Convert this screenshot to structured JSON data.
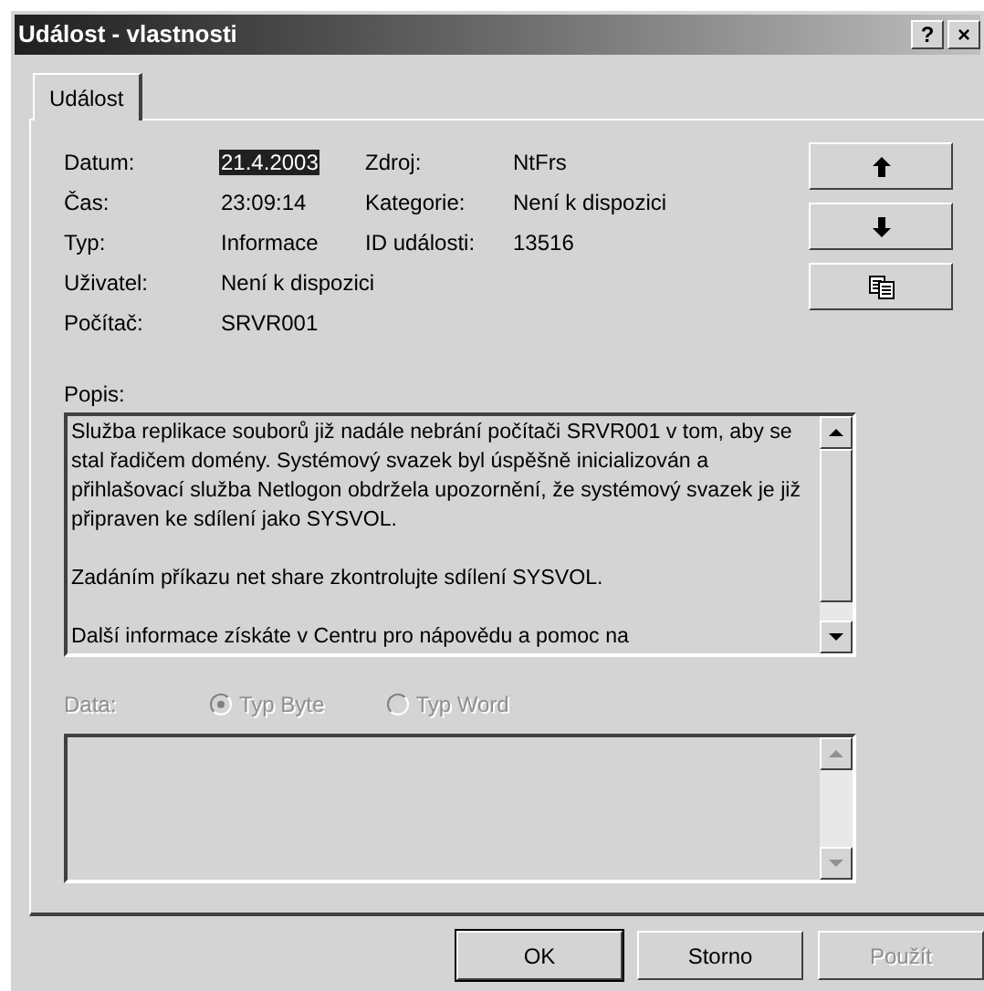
{
  "window": {
    "title": "Událost - vlastnosti",
    "title_buttons": [
      "?",
      "×"
    ]
  },
  "tabs": [
    {
      "label": "Událost",
      "selected": true
    }
  ],
  "fields": [
    {
      "label": "Datum:",
      "value": "21.4.2003",
      "selected": true,
      "label_2": "Zdroj:",
      "value_2": "NtFrs"
    },
    {
      "label": "Čas:",
      "value": "23:09:14",
      "selected": false,
      "label_2": "Kategorie:",
      "value_2": "Není k dispozici"
    },
    {
      "label": "Typ:",
      "value": "Informace",
      "selected": false,
      "label_2": "ID události:",
      "value_2": "13516"
    },
    {
      "label": "Uživatel:",
      "value": "Není k dispozici",
      "selected": false
    },
    {
      "label": "Počítač:",
      "value": "SRVR001",
      "selected": false
    }
  ],
  "side_buttons": [
    {
      "kind": "up"
    },
    {
      "kind": "down"
    },
    {
      "kind": "copy"
    }
  ],
  "description": {
    "label": "Popis:",
    "paragraphs": [
      "Služba replikace souborů již nadále nebrání počítači SRVR001 v tom, aby se stal řadičem domény. Systémový svazek byl úspěšně inicializován a přihlašovací služba Netlogon obdržela upozornění, že systémový svazek je již připraven ke sdílení jako SYSVOL.",
      "Zadáním příkazu net share zkontrolujte sdílení SYSVOL.",
      "Další informace získáte v Centru pro nápovědu a pomoc na"
    ]
  },
  "data": {
    "label": "Data:",
    "disabled": true,
    "options": [
      {
        "label": "Typ Byte",
        "selected": true
      },
      {
        "label": "Typ Word",
        "selected": false
      }
    ]
  },
  "buttons": [
    {
      "label": "OK",
      "default": true,
      "disabled": false
    },
    {
      "label": "Storno",
      "default": false,
      "disabled": false
    },
    {
      "label": "Použít",
      "default": false,
      "disabled": true
    }
  ]
}
